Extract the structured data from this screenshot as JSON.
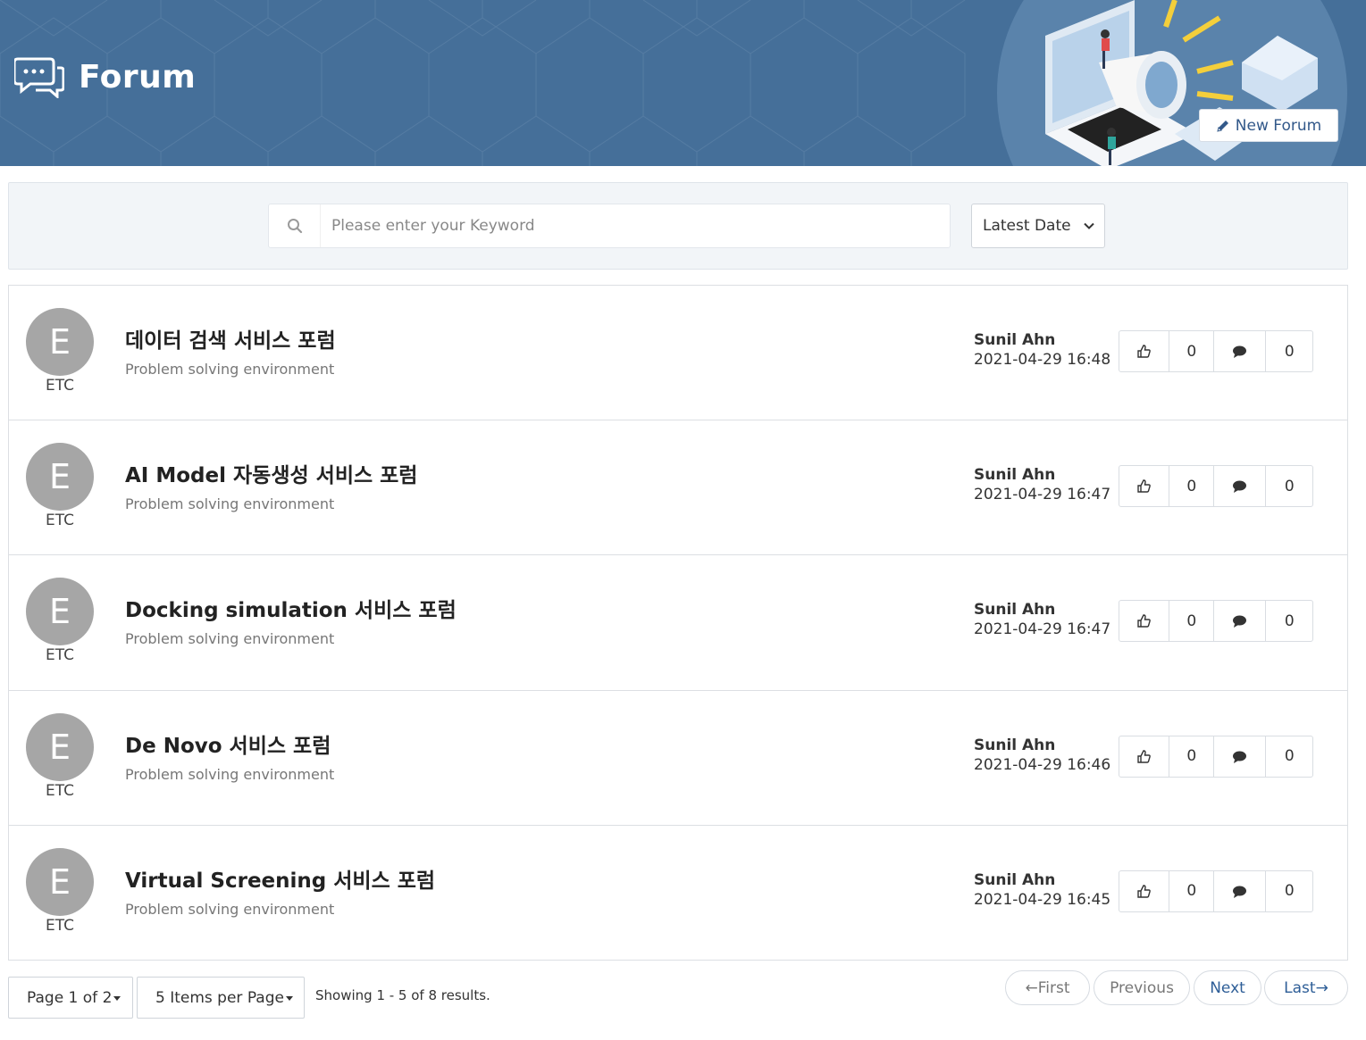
{
  "header": {
    "title": "Forum",
    "new_forum_label": "New Forum"
  },
  "search": {
    "placeholder": "Please enter your Keyword",
    "sort_selected": "Latest Date"
  },
  "forums": [
    {
      "avatar": "E",
      "category": "ETC",
      "title": "데이터 검색 서비스 포럼",
      "subtitle": "Problem solving environment",
      "author": "Sunil Ahn",
      "date": "2021-04-29 16:48",
      "likes": "0",
      "comments": "0"
    },
    {
      "avatar": "E",
      "category": "ETC",
      "title": "AI Model 자동생성 서비스 포럼",
      "subtitle": "Problem solving environment",
      "author": "Sunil Ahn",
      "date": "2021-04-29 16:47",
      "likes": "0",
      "comments": "0"
    },
    {
      "avatar": "E",
      "category": "ETC",
      "title": "Docking simulation 서비스 포럼",
      "subtitle": "Problem solving environment",
      "author": "Sunil Ahn",
      "date": "2021-04-29 16:47",
      "likes": "0",
      "comments": "0"
    },
    {
      "avatar": "E",
      "category": "ETC",
      "title": "De Novo 서비스 포럼",
      "subtitle": "Problem solving environment",
      "author": "Sunil Ahn",
      "date": "2021-04-29 16:46",
      "likes": "0",
      "comments": "0"
    },
    {
      "avatar": "E",
      "category": "ETC",
      "title": "Virtual Screening 서비스 포럼",
      "subtitle": "Problem solving environment",
      "author": "Sunil Ahn",
      "date": "2021-04-29 16:45",
      "likes": "0",
      "comments": "0"
    }
  ],
  "pagination": {
    "page_label": "Page 1 of 2",
    "items_per_page_label": "5 Items per Page",
    "showing": "Showing 1 - 5 of 8 results.",
    "first": "←First",
    "previous": "Previous",
    "next": "Next",
    "last": "Last→"
  },
  "colors": {
    "banner": "#456f99",
    "link": "#2e5e97",
    "avatar": "#a6a6a6"
  }
}
